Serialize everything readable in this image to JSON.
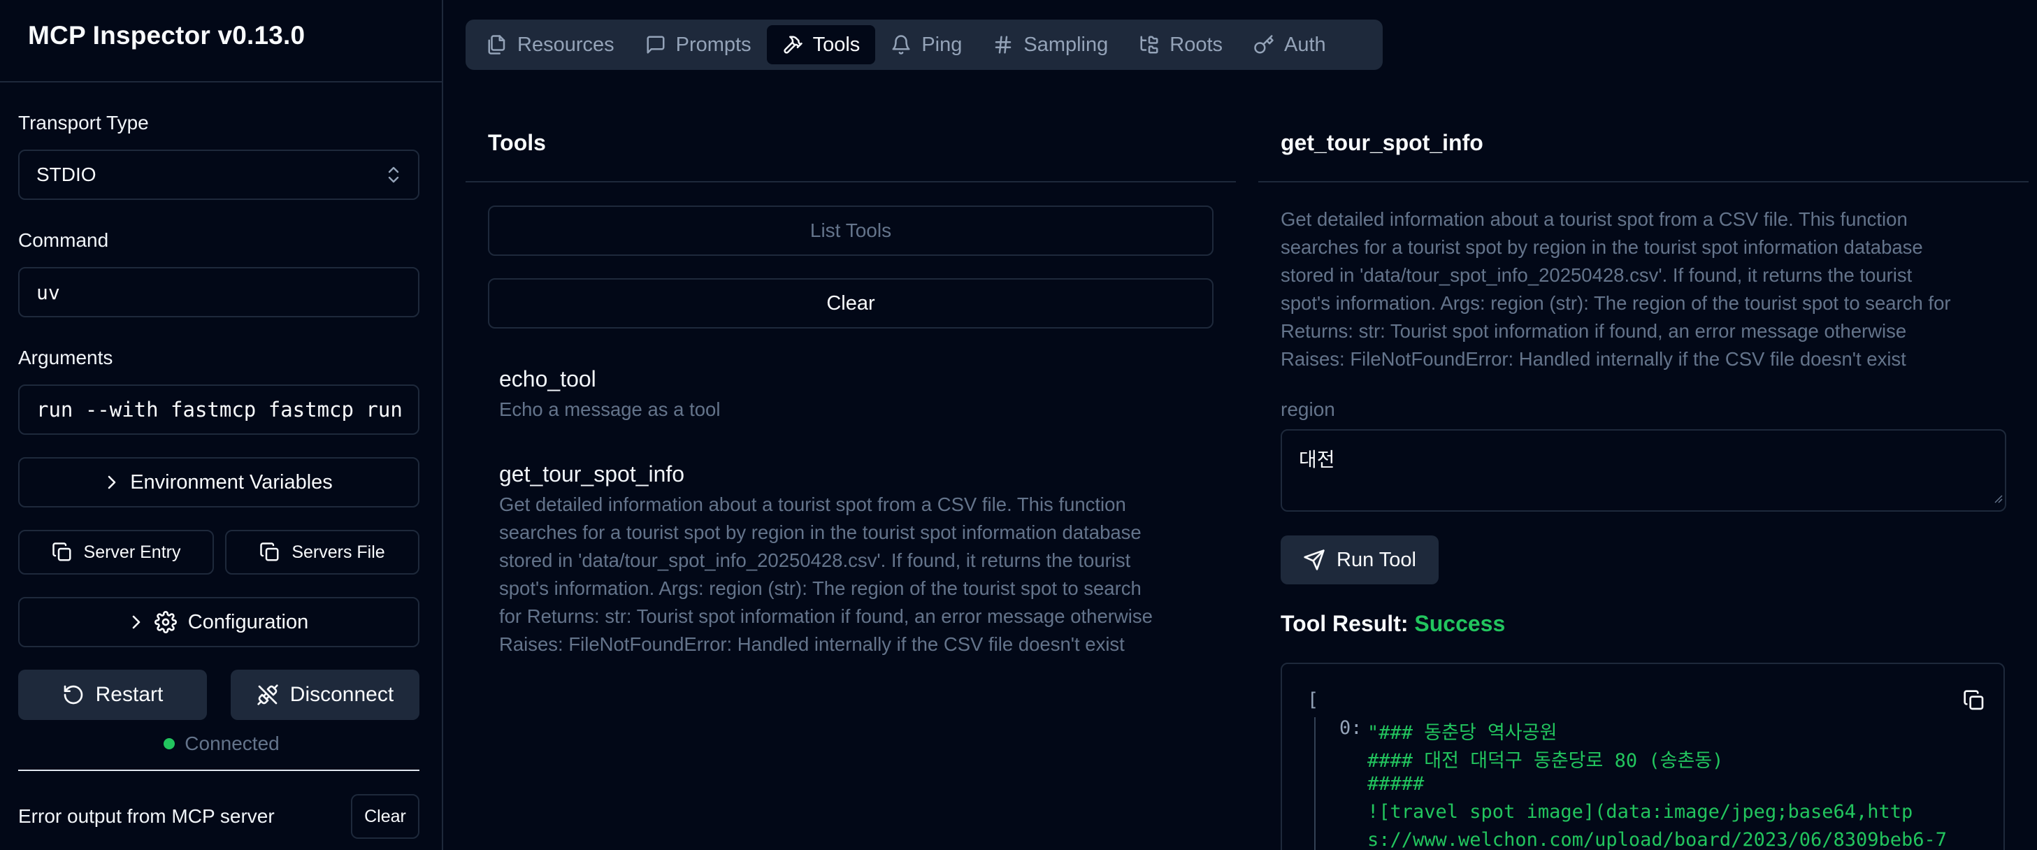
{
  "app": {
    "title": "MCP Inspector v0.13.0"
  },
  "sidebar": {
    "transport_label": "Transport Type",
    "transport_value": "STDIO",
    "command_label": "Command",
    "command_value": "uv",
    "arguments_label": "Arguments",
    "arguments_value": "run --with fastmcp fastmcp run",
    "env_button": "Environment Variables",
    "server_entry_button": "Server Entry",
    "servers_file_button": "Servers File",
    "configuration_button": "Configuration",
    "restart_button": "Restart",
    "disconnect_button": "Disconnect",
    "status_text": "Connected",
    "status_color": "#22c55e",
    "error_label": "Error output from MCP server",
    "error_clear_button": "Clear"
  },
  "tabs": [
    {
      "label": "Resources",
      "icon": "files-icon"
    },
    {
      "label": "Prompts",
      "icon": "message-square-icon"
    },
    {
      "label": "Tools",
      "icon": "hammer-icon",
      "active": true
    },
    {
      "label": "Ping",
      "icon": "bell-icon"
    },
    {
      "label": "Sampling",
      "icon": "hash-icon"
    },
    {
      "label": "Roots",
      "icon": "folder-tree-icon"
    },
    {
      "label": "Auth",
      "icon": "key-icon"
    }
  ],
  "tools_panel": {
    "title": "Tools",
    "list_button": "List Tools",
    "clear_button": "Clear",
    "tools": [
      {
        "name": "echo_tool",
        "description": [
          "Echo a message as a tool"
        ]
      },
      {
        "name": "get_tour_spot_info",
        "description": [
          "Get detailed information about a tourist spot from a CSV file. This function",
          "searches for a tourist spot by region in the tourist spot information database",
          "stored in 'data/tour_spot_info_20250428.csv'. If found, it returns the tourist",
          "spot's information. Args: region (str): The region of the tourist spot to search",
          "for Returns: str: Tourist spot information if found, an error message otherwise",
          "Raises: FileNotFoundError: Handled internally if the CSV file doesn't exist"
        ]
      }
    ]
  },
  "detail_panel": {
    "title": "get_tour_spot_info",
    "description": [
      "Get detailed information about a tourist spot from a CSV file. This function",
      "searches for a tourist spot by region in the tourist spot information database",
      "stored in 'data/tour_spot_info_20250428.csv'. If found, it returns the tourist",
      "spot's information. Args: region (str): The region of the tourist spot to search for",
      "Returns: str: Tourist spot information if found, an error message otherwise",
      "Raises: FileNotFoundError: Handled internally if the CSV file doesn't exist"
    ],
    "param_label": "region",
    "param_value": "대전",
    "run_button": "Run Tool",
    "result_label": "Tool Result:",
    "result_status": "Success",
    "result_status_color": "#22c55e",
    "result_json": {
      "open_bracket": "[",
      "index": "0:",
      "lines": [
        "\"### 동춘당 역사공원",
        "#### 대전 대덕구 동춘당로 80 (송촌동)",
        "#####",
        "![travel spot image](data:image/jpeg;base64,http",
        "s://www.welchon.com/upload/board/2023/06/8309beb6-7"
      ]
    }
  }
}
